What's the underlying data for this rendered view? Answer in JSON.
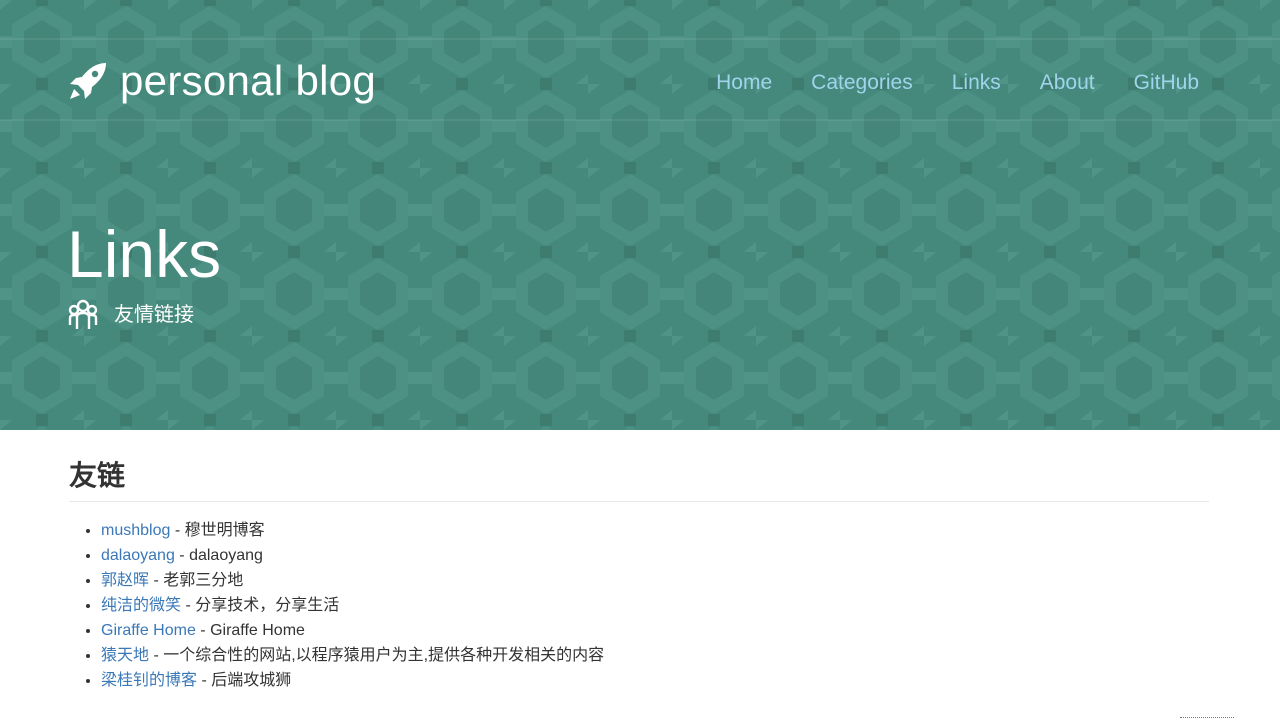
{
  "header": {
    "brand": "personal blog",
    "brand_icon": "rocket-icon",
    "nav": [
      {
        "label": "Home"
      },
      {
        "label": "Categories"
      },
      {
        "label": "Links"
      },
      {
        "label": "About"
      },
      {
        "label": "GitHub"
      }
    ],
    "title": "Links",
    "subtitle_icon": "users-icon",
    "subtitle": "友情链接"
  },
  "main": {
    "heading": "友链",
    "links": [
      {
        "name": "mushblog",
        "desc": " - 穆世明博客"
      },
      {
        "name": "dalaoyang",
        "desc": " - dalaoyang"
      },
      {
        "name": "郭赵晖",
        "desc": " - 老郭三分地"
      },
      {
        "name": "纯洁的微笑",
        "desc": " - 分享技术，分享生活"
      },
      {
        "name": "Giraffe Home",
        "desc": " - Giraffe Home"
      },
      {
        "name": "猿天地",
        "desc": " - 一个综合性的网站,以程序猿用户为主,提供各种开发相关的内容"
      },
      {
        "name": "梁桂钊的博客",
        "desc": " - 后端攻城狮"
      }
    ]
  },
  "colors": {
    "hero_bg": "#45897c",
    "nav_link": "#9fd4ec",
    "content_link": "#3b78b8",
    "text": "#333333"
  }
}
